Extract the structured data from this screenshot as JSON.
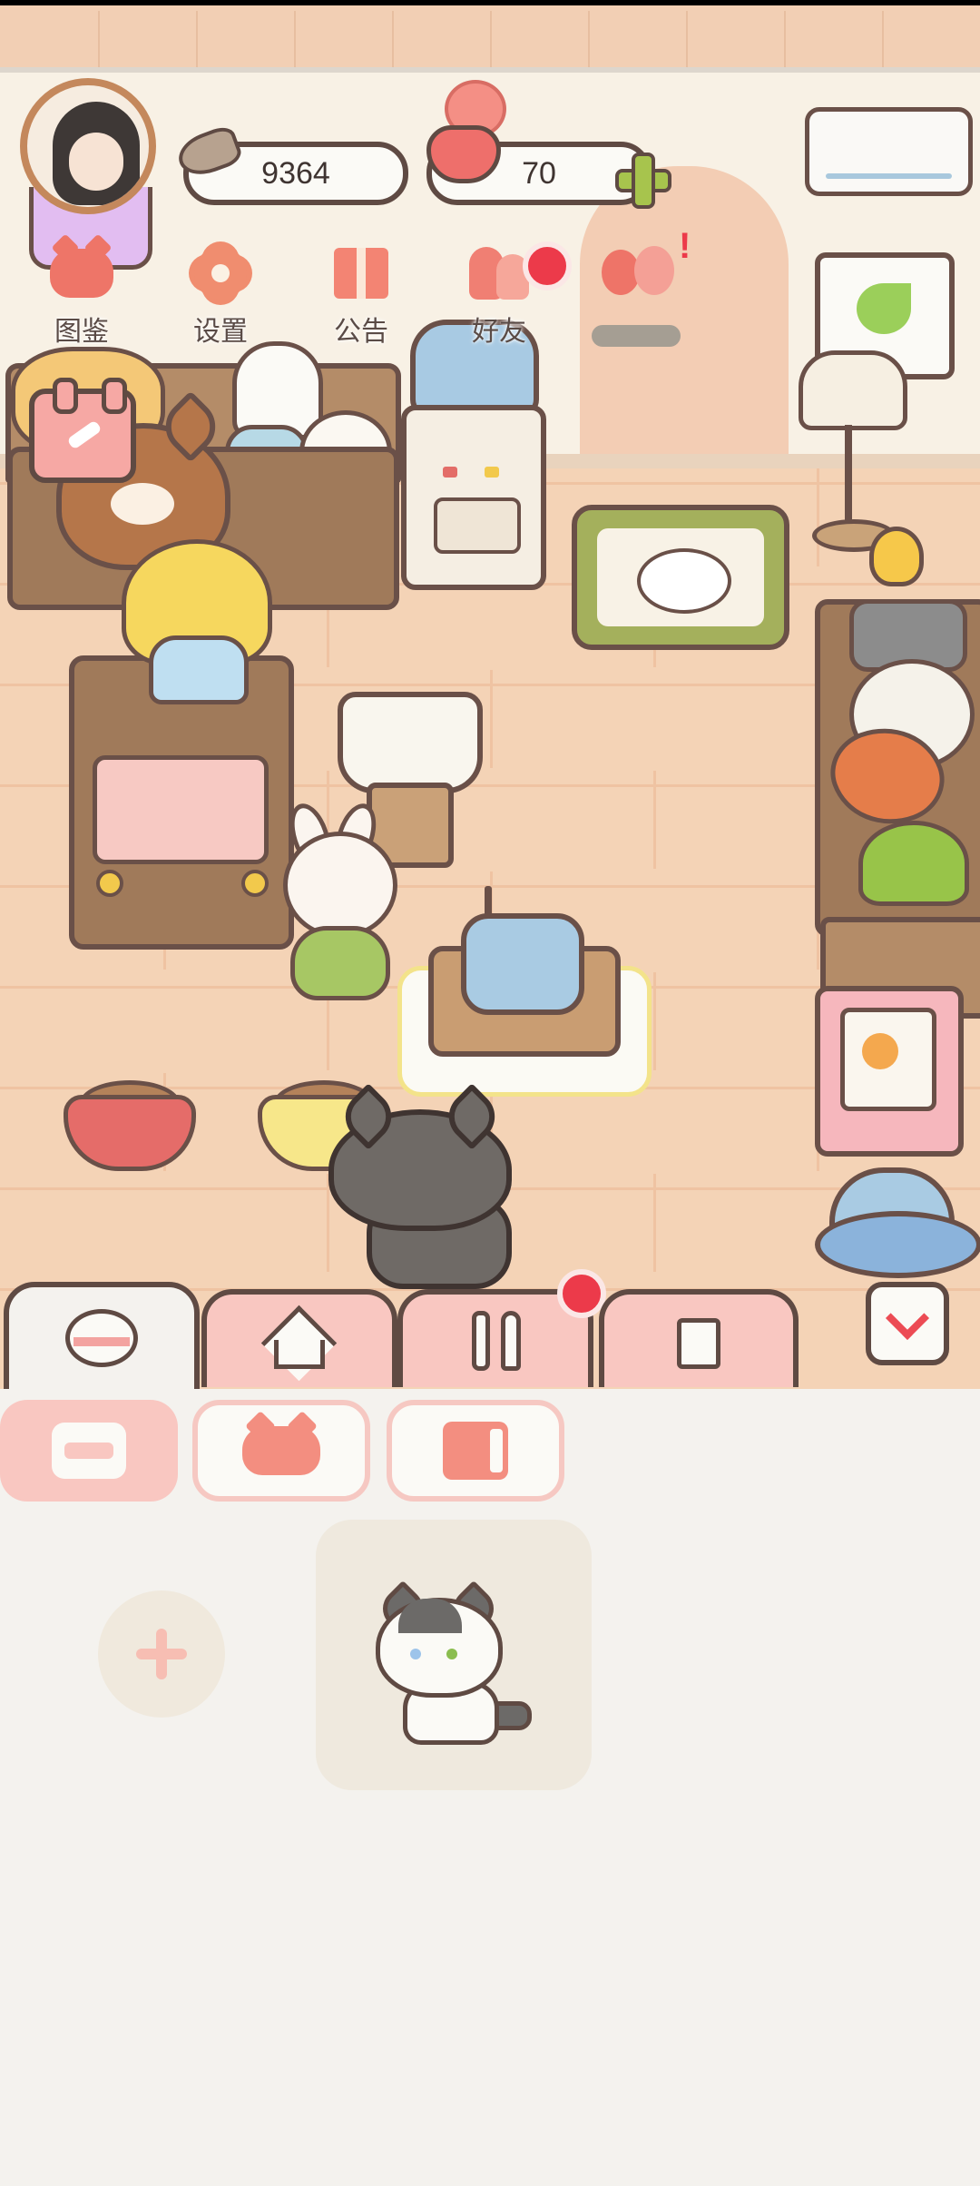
{
  "hud": {
    "fish_count": "9364",
    "heart_count": "70"
  },
  "menu": {
    "items": [
      {
        "label": "图鉴",
        "icon": "cat-book-icon"
      },
      {
        "label": "设置",
        "icon": "gear-icon"
      },
      {
        "label": "公告",
        "icon": "gift-icon"
      },
      {
        "label": "好友",
        "icon": "friends-icon"
      },
      {
        "label": "",
        "icon": "hearts-icon"
      }
    ]
  },
  "tabs": [
    {
      "icon": "food-bowl-icon",
      "active": true
    },
    {
      "icon": "house-icon",
      "active": false
    },
    {
      "icon": "cutlery-icon",
      "active": false,
      "badge": true
    },
    {
      "icon": "shirt-icon",
      "active": false
    }
  ],
  "filters": [
    {
      "icon": "all-icon",
      "active": true
    },
    {
      "icon": "cat-icon",
      "active": false
    },
    {
      "icon": "book-icon",
      "active": false
    }
  ],
  "colors": {
    "accent_pink": "#f9c7c1",
    "outline": "#5f4a43",
    "badge_red": "#ec3a4a",
    "panel_bg": "#f4f2ee"
  }
}
